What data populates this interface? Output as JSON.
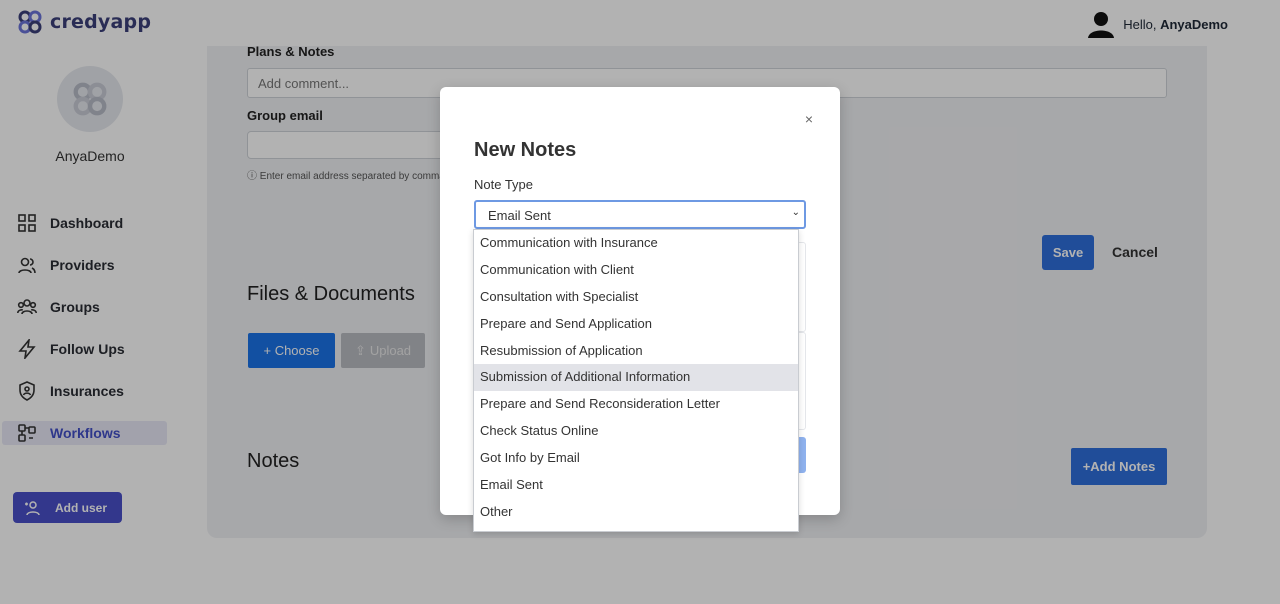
{
  "brand": {
    "name": "credyapp"
  },
  "header": {
    "greeting": "Hello,",
    "username": "AnyaDemo"
  },
  "sidebar": {
    "profile_name": "AnyaDemo",
    "items": [
      {
        "label": "Dashboard",
        "icon": "dashboard-icon"
      },
      {
        "label": "Providers",
        "icon": "providers-icon"
      },
      {
        "label": "Groups",
        "icon": "groups-icon"
      },
      {
        "label": "Follow Ups",
        "icon": "lightning-icon"
      },
      {
        "label": "Insurances",
        "icon": "shield-user-icon"
      },
      {
        "label": "Workflows",
        "icon": "workflows-icon"
      }
    ],
    "active": "Workflows",
    "add_user_label": "Add user"
  },
  "main": {
    "plans_label": "Plans & Notes",
    "comment_placeholder": "Add comment...",
    "group_email_label": "Group email",
    "group_email_hint": "Enter email address separated by comma",
    "save_label": "Save",
    "cancel_label": "Cancel",
    "files_title": "Files & Documents",
    "choose_label": "+ Choose",
    "upload_label": "Upload",
    "notes_title": "Notes",
    "add_notes_label": "+Add Notes"
  },
  "modal": {
    "close": "×",
    "title": "New Notes",
    "note_type_label": "Note Type",
    "selected": "Email Sent",
    "options": [
      "Communication with Insurance",
      "Communication with Client",
      "Consultation with Specialist",
      "Prepare and Send Application",
      "Resubmission of Application",
      "Submission of Additional Information",
      "Prepare and Send Reconsideration Letter",
      "Check Status Online",
      "Got Info by Email",
      "Email Sent",
      "Other"
    ],
    "highlighted": "Submission of Additional Information"
  },
  "colors": {
    "accent": "#4a50c9",
    "primary_button": "#2f6fdc"
  }
}
